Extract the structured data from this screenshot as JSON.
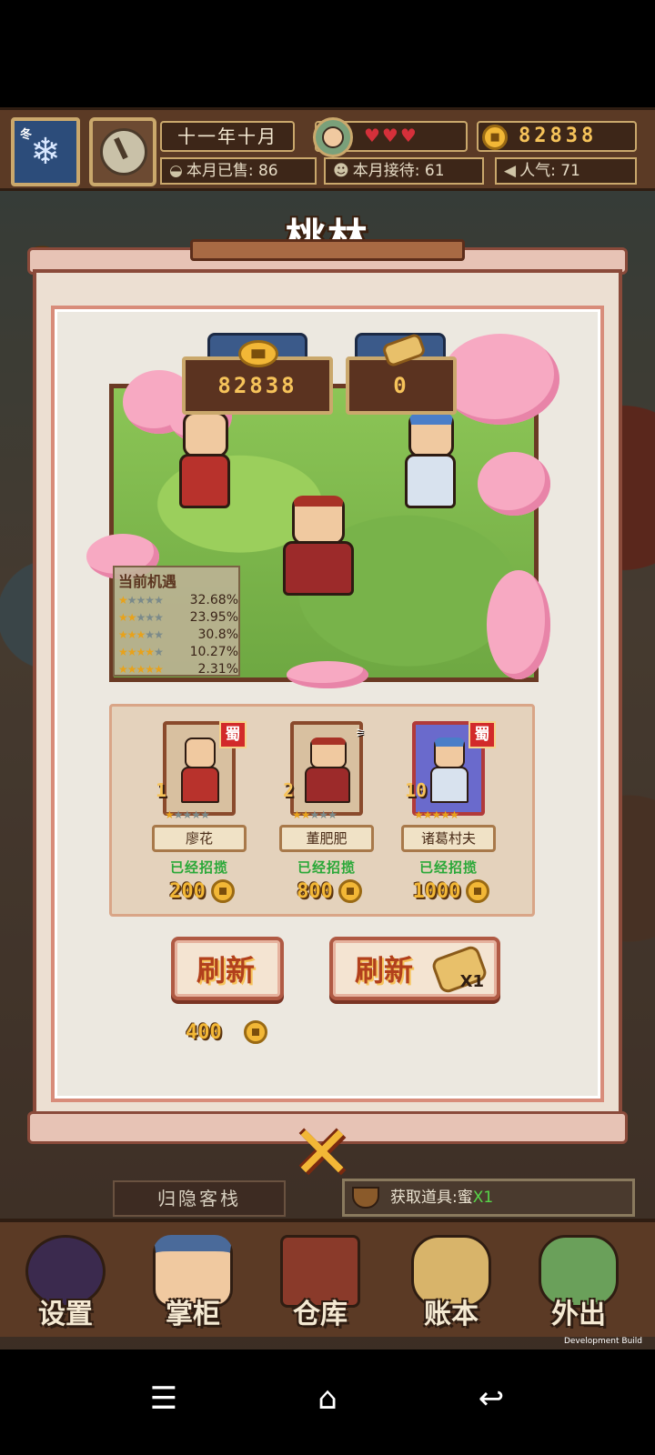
{
  "hud": {
    "season": "冬",
    "date": "十一年十月",
    "hearts": "♥♥♥",
    "gold": "82838",
    "sold_label": "本月已售:",
    "sold_value": "86",
    "served_label": "本月接待:",
    "served_value": "61",
    "popularity_label": "人气:",
    "popularity_value": "71"
  },
  "title": "桃林",
  "help": "?",
  "scene": {
    "coin_value": "82838",
    "scroll_value": "0"
  },
  "odds": {
    "title": "当前机遇",
    "rows": [
      {
        "stars": 1,
        "percent": "32.68%"
      },
      {
        "stars": 2,
        "percent": "23.95%"
      },
      {
        "stars": 3,
        "percent": "30.8%"
      },
      {
        "stars": 4,
        "percent": "10.27%"
      },
      {
        "stars": 5,
        "percent": "2.31%"
      }
    ]
  },
  "hires": [
    {
      "name": "廖花",
      "level": "1",
      "faction": "蜀",
      "status": "已经招揽",
      "price": "200",
      "stars": 1
    },
    {
      "name": "董肥肥",
      "level": "2",
      "faction": "",
      "status": "已经招揽",
      "price": "800",
      "stars": 2
    },
    {
      "name": "诸葛村夫",
      "level": "10",
      "faction": "蜀",
      "status": "已经招揽",
      "price": "1000",
      "stars": 5
    }
  ],
  "buttons": {
    "refresh_coin": "刷新",
    "refresh_scroll": "刷新",
    "scroll_count": "X1",
    "refresh_cost": "400"
  },
  "close": "✕",
  "inn_name": "归隐客栈",
  "acquire": {
    "label": "获取道具:蜜",
    "count": "X1"
  },
  "nav": {
    "settings": "设置",
    "manager": "掌柜",
    "warehouse": "仓库",
    "ledger": "账本",
    "outing": "外出"
  },
  "dev_build": "Development Build",
  "colors": {
    "gold": "#f6c35a",
    "hired_green": "#2aa838",
    "frame_brown": "#5b3a25",
    "refresh_red": "#b2401c"
  }
}
